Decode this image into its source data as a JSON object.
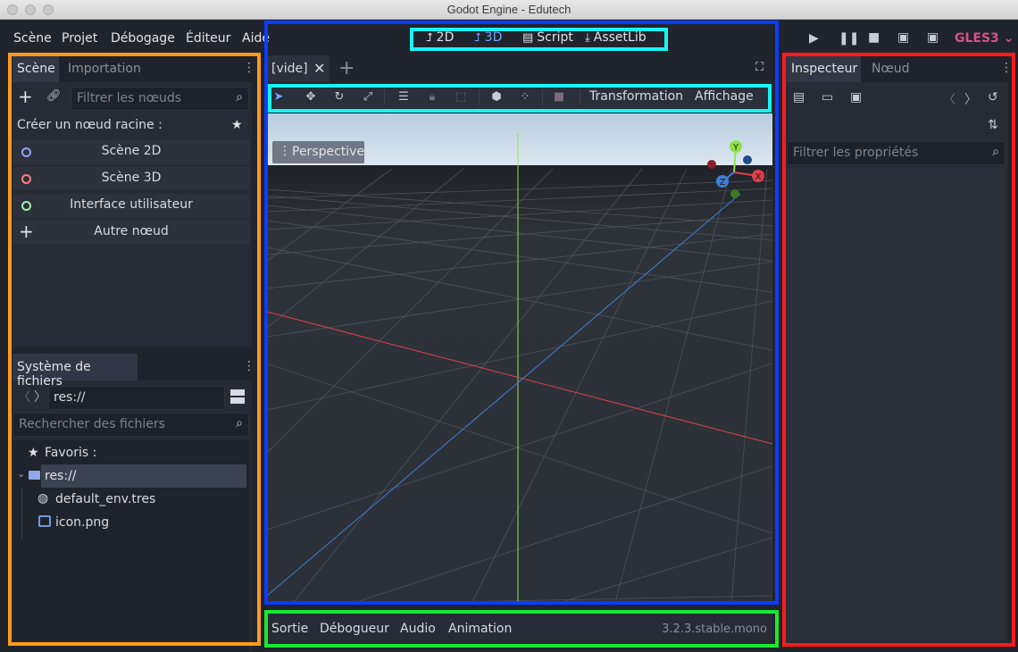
{
  "window": {
    "title": "Godot Engine - Edutech"
  },
  "menu": [
    "Scène",
    "Projet",
    "Débogage",
    "Éditeur",
    "Aide"
  ],
  "modes": [
    {
      "label": "2D",
      "icon": "2d-icon"
    },
    {
      "label": "3D",
      "icon": "3d-icon"
    },
    {
      "label": "Script",
      "icon": "script-icon"
    },
    {
      "label": "AssetLib",
      "icon": "download-icon"
    }
  ],
  "renderer": "GLES3",
  "scene_dock": {
    "tabs": [
      "Scène",
      "Importation"
    ],
    "filter_placeholder": "Filtrer les nœuds",
    "root_title": "Créer un nœud racine :",
    "root_items": [
      {
        "label": "Scène 2D",
        "color": "#8da5f3"
      },
      {
        "label": "Scène 3D",
        "color": "#fc7f7f"
      },
      {
        "label": "Interface utilisateur",
        "color": "#a5efac"
      },
      {
        "label": "Autre nœud",
        "color": ""
      }
    ]
  },
  "filesystem": {
    "tab": "Système de fichiers",
    "path": "res://",
    "search_placeholder": "Rechercher des fichiers",
    "favorites": "Favoris :",
    "root": "res://",
    "files": [
      "default_env.tres",
      "icon.png"
    ]
  },
  "viewport": {
    "scene_tab": "[vide]",
    "toolbar_menus": [
      "Transformation",
      "Affichage"
    ],
    "perspective": "Perspective",
    "gizmo_labels": [
      "Y",
      "X",
      "Z"
    ]
  },
  "bottom": {
    "tabs": [
      "Sortie",
      "Débogueur",
      "Audio",
      "Animation"
    ],
    "version": "3.2.3.stable.mono"
  },
  "inspector": {
    "tabs": [
      "Inspecteur",
      "Nœud"
    ],
    "filter_placeholder": "Filtrer les propriétés"
  },
  "colors": {
    "highlight_orange": "#ff9a1f",
    "highlight_blue": "#0a3dff",
    "highlight_cyan": "#19f4f4",
    "highlight_green": "#19e830",
    "highlight_red": "#ff1a1a",
    "accent": "#6ea9ff",
    "renderer": "#d8528a"
  }
}
